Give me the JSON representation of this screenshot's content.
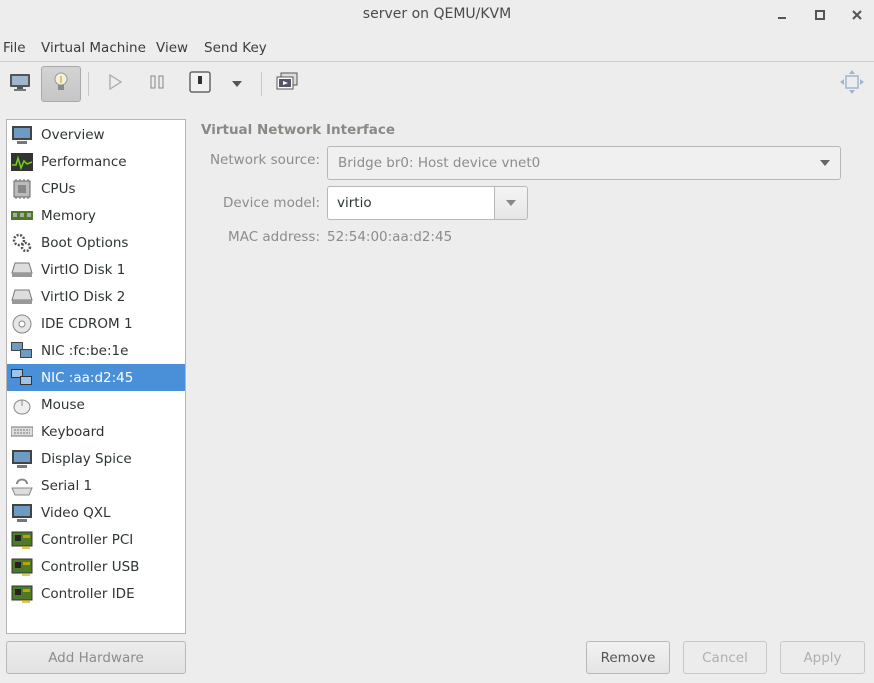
{
  "window": {
    "title": "server on QEMU/KVM",
    "minimize_icon": "minimize-icon",
    "maximize_icon": "maximize-icon",
    "close_icon": "close-icon"
  },
  "menubar": {
    "items": [
      "File",
      "Virtual Machine",
      "View",
      "Send Key"
    ]
  },
  "toolbar": {
    "buttons": [
      {
        "icon": "monitor-icon",
        "active": false
      },
      {
        "icon": "lightbulb-icon",
        "active": true
      },
      {
        "icon": "play-icon",
        "active": false
      },
      {
        "icon": "pause-icon",
        "active": false
      },
      {
        "icon": "power-icon",
        "active": false
      },
      {
        "icon": "chevron-down-icon",
        "active": false
      },
      {
        "icon": "snapshot-icon",
        "active": false
      },
      {
        "icon": "fullscreen-icon",
        "active": false
      }
    ]
  },
  "sidebar": {
    "items": [
      {
        "label": "Overview",
        "icon": "overview-monitor-icon"
      },
      {
        "label": "Performance",
        "icon": "performance-chart-icon"
      },
      {
        "label": "CPUs",
        "icon": "cpu-chip-icon"
      },
      {
        "label": "Memory",
        "icon": "memory-stick-icon"
      },
      {
        "label": "Boot Options",
        "icon": "gears-icon"
      },
      {
        "label": "VirtIO Disk 1",
        "icon": "hard-disk-icon"
      },
      {
        "label": "VirtIO Disk 2",
        "icon": "hard-disk-icon"
      },
      {
        "label": "IDE CDROM 1",
        "icon": "cdrom-icon"
      },
      {
        "label": "NIC :fc:be:1e",
        "icon": "network-icon"
      },
      {
        "label": "NIC :aa:d2:45",
        "icon": "network-icon",
        "selected": true
      },
      {
        "label": "Mouse",
        "icon": "mouse-icon"
      },
      {
        "label": "Keyboard",
        "icon": "keyboard-icon"
      },
      {
        "label": "Display Spice",
        "icon": "display-monitor-icon"
      },
      {
        "label": "Serial 1",
        "icon": "serial-icon"
      },
      {
        "label": "Video QXL",
        "icon": "video-monitor-icon"
      },
      {
        "label": "Controller PCI",
        "icon": "controller-card-icon"
      },
      {
        "label": "Controller USB",
        "icon": "controller-card-icon"
      },
      {
        "label": "Controller IDE",
        "icon": "controller-card-icon"
      }
    ],
    "selected_color": "#4a90d9"
  },
  "details": {
    "section_title": "Virtual Network Interface",
    "network_source_label": "Network source:",
    "network_source_value": "Bridge br0: Host device vnet0",
    "device_model_label": "Device model:",
    "device_model_value": "virtio",
    "mac_label": "MAC address:",
    "mac_value": "52:54:00:aa:d2:45"
  },
  "buttons": {
    "add_hardware": "Add Hardware",
    "remove": "Remove",
    "cancel": "Cancel",
    "apply": "Apply"
  }
}
